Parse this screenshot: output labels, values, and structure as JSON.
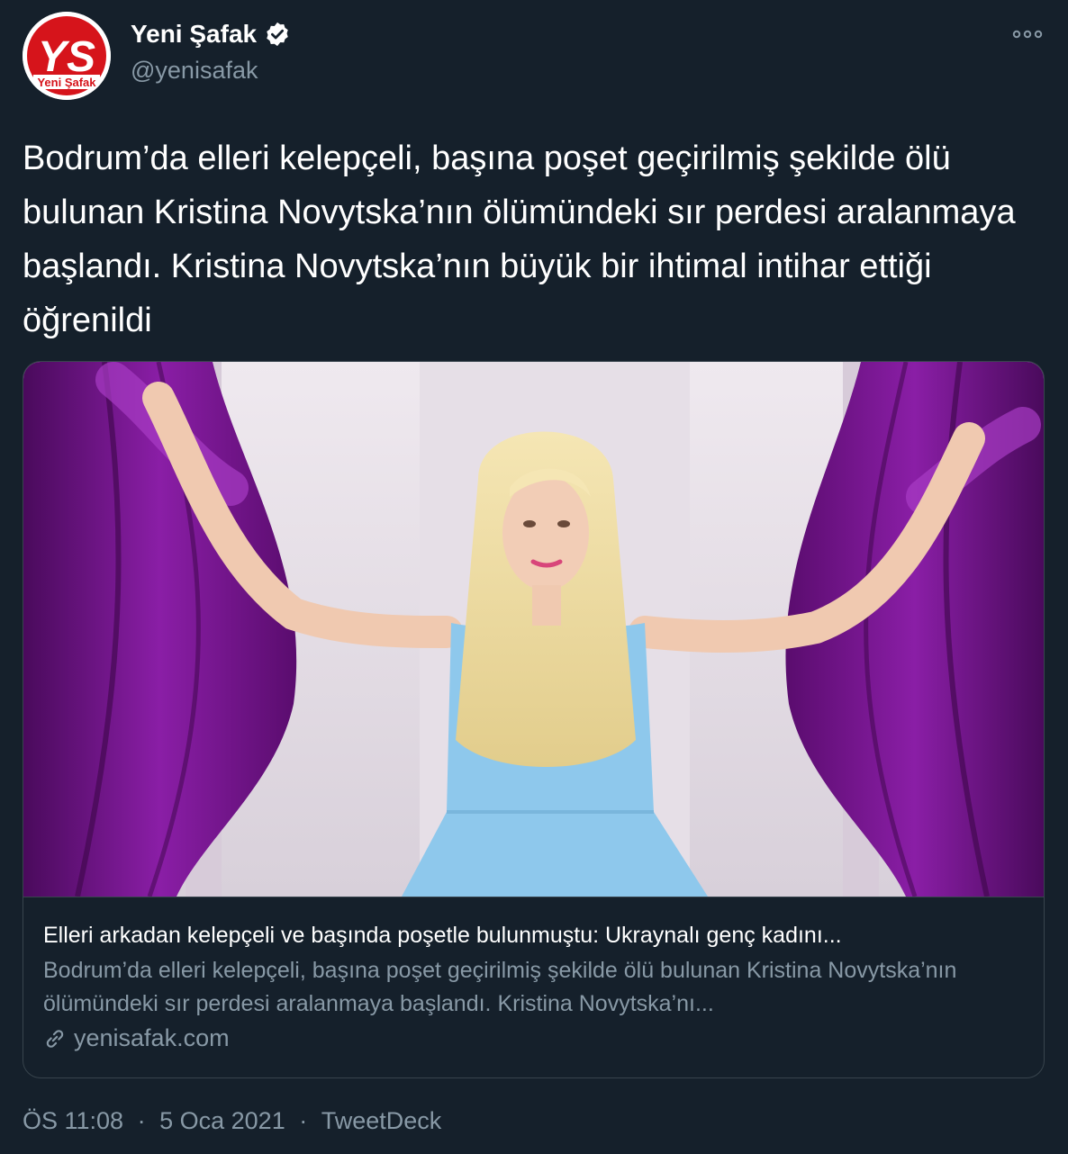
{
  "author": {
    "display_name": "Yeni Şafak",
    "handle": "@yenisafak",
    "avatar_logo_text": "YS",
    "avatar_logo_subtext": "Yeni Şafak",
    "verified_icon": "verified-badge-icon",
    "brand_color": "#d6141b"
  },
  "tweet": {
    "text": "Bodrum’da elleri kelepçeli, başına poşet geçirilmiş şekilde ölü bulunan Kristina Novytska’nın ölümündeki sır perdesi aralanmaya başlandı. Kristina Novytska’nın büyük bir ihtimal intihar ettiği öğrenildi"
  },
  "card": {
    "image_description_icon": "article-photo",
    "title": "Elleri arkadan kelepçeli ve başında poşetle bulunmuştu: Ukraynalı genç kadını...",
    "description": "Bodrum’da elleri kelepçeli, başına poşet geçirilmiş şekilde ölü bulunan Kristina Novytska’nın ölümündeki sır perdesi aralanmaya başlandı. Kristina Novytska’nı...",
    "domain": "yenisafak.com"
  },
  "meta": {
    "time": "ÖS 11:08",
    "separator": "·",
    "date": "5 Oca 2021",
    "source": "TweetDeck"
  },
  "colors": {
    "background": "#15202b",
    "text_primary": "#ffffff",
    "text_secondary": "#8899a6",
    "border": "#38444d"
  }
}
